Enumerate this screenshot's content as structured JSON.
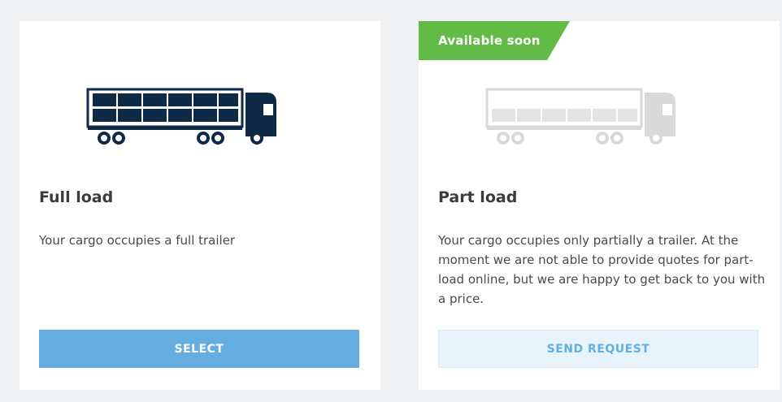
{
  "options": [
    {
      "title": "Full load",
      "description": "Your cargo occupies a full trailer",
      "button_label": "SELECT"
    },
    {
      "badge": "Available soon",
      "title": "Part load",
      "description": "Your cargo occupies only  partially a trailer. At the moment we are not able to provide quotes for part-load online, but we are happy to get back to you with a price.",
      "button_label": "SEND REQUEST"
    }
  ],
  "colors": {
    "page_bg": "#eef0f2",
    "truck_dark": "#0e2a47",
    "truck_disabled": "#d9d9d9",
    "badge_green": "#61bb46",
    "button_blue": "#66aee1",
    "button_light": "#e7f3fb"
  },
  "icons": {
    "full_load": "truck-full-icon",
    "part_load": "truck-part-icon"
  }
}
